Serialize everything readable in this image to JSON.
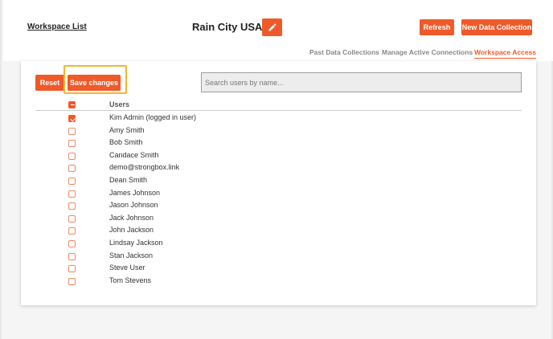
{
  "header": {
    "workspace_list_link": "Workspace List",
    "workspace_name": "Rain City USA",
    "refresh_label": "Refresh",
    "new_data_collection_label": "New Data Collection"
  },
  "tabs": [
    {
      "label": "Past Data Collections",
      "active": false
    },
    {
      "label": "Manage Active Connections",
      "active": false
    },
    {
      "label": "Workspace Access",
      "active": true
    }
  ],
  "toolbar": {
    "reset_label": "Reset",
    "save_label": "Save changes",
    "search_placeholder": "Search users by name..."
  },
  "table": {
    "header_label": "Users",
    "select_all_state": "indeterminate",
    "users": [
      {
        "name": "Kim Admin (logged in user)",
        "checked": true
      },
      {
        "name": "Amy Smith",
        "checked": false
      },
      {
        "name": "Bob Smith",
        "checked": false
      },
      {
        "name": "Candace Smith",
        "checked": false
      },
      {
        "name": "demo@strongbox.link",
        "checked": false
      },
      {
        "name": "Dean Smith",
        "checked": false
      },
      {
        "name": "James Johnson",
        "checked": false
      },
      {
        "name": "Jason Johnson",
        "checked": false
      },
      {
        "name": "Jack Johnson",
        "checked": false
      },
      {
        "name": "John Jackson",
        "checked": false
      },
      {
        "name": "Lindsay Jackson",
        "checked": false
      },
      {
        "name": "Stan Jackson",
        "checked": false
      },
      {
        "name": "Steve User",
        "checked": false
      },
      {
        "name": "Tom Stevens",
        "checked": false
      }
    ]
  },
  "colors": {
    "accent": "#ef5a2a",
    "highlight": "#f2b731"
  },
  "icons": {
    "edit": "pencil-icon"
  }
}
